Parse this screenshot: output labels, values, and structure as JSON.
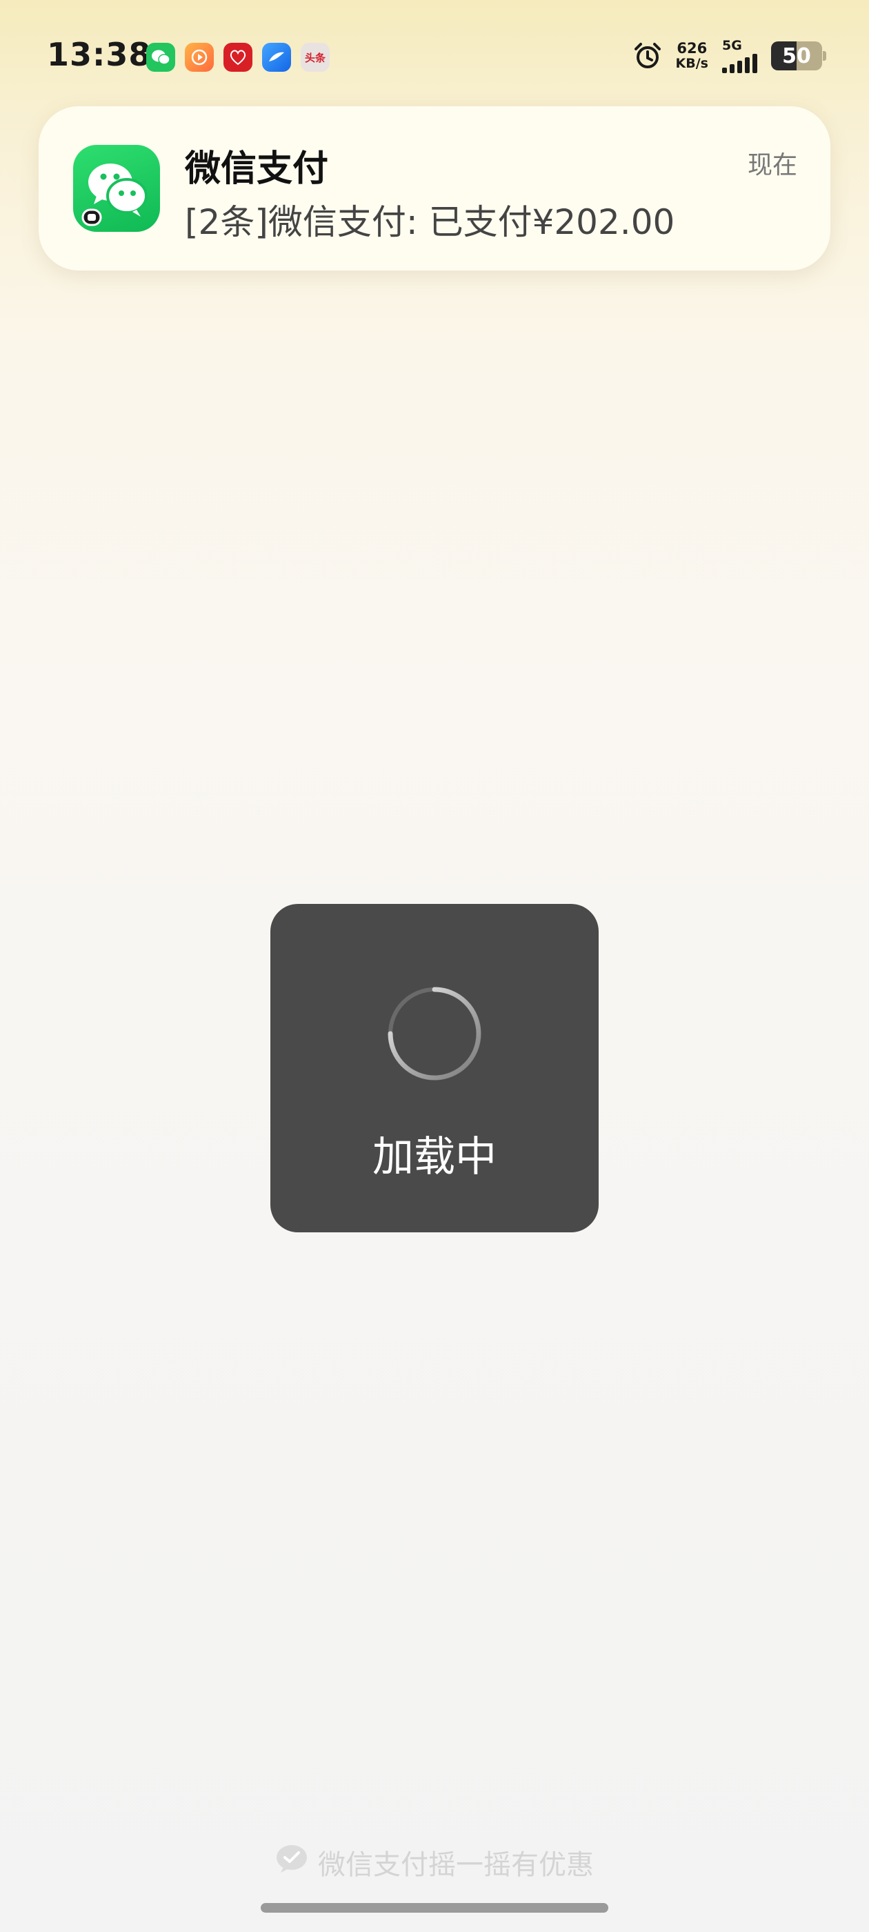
{
  "status_bar": {
    "time": "13:38",
    "net_speed_value": "626",
    "net_speed_unit": "KB/s",
    "network_type": "5G",
    "battery": "50",
    "app_icons": [
      "wechat-icon",
      "video-app-icon",
      "red-app-icon",
      "blue-app-icon",
      "toutiao-icon"
    ],
    "mini_news_label": "头条"
  },
  "notification": {
    "app_name": "微信支付",
    "time": "现在",
    "message": "[2条]微信支付: 已支付¥202.00",
    "icon": "wechat-icon",
    "accent_color": "#22c55e"
  },
  "loading": {
    "text": "加载中"
  },
  "footer": {
    "promo_text": "微信支付摇一摇有优惠",
    "icon": "wechat-pay-icon"
  }
}
